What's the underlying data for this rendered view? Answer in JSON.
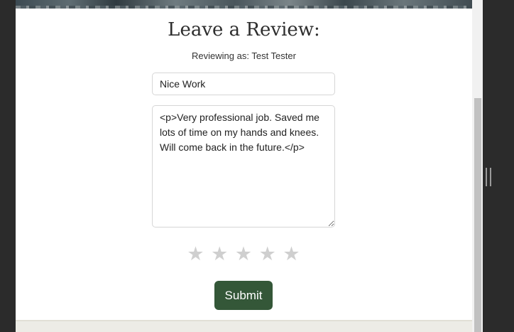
{
  "review": {
    "title": "Leave a Review:",
    "reviewer_line": "Reviewing as: Test Tester",
    "subject_value": "Nice Work",
    "body_value": "<p>Very professional job. Saved me lots of time on my hands and knees. Will come back in the future.</p>",
    "stars": [
      "★",
      "★",
      "★",
      "★",
      "★"
    ],
    "rating": 0,
    "submit_label": "Submit"
  },
  "colors": {
    "submit_bg": "#345738",
    "star_inactive": "#cfcfcf"
  }
}
